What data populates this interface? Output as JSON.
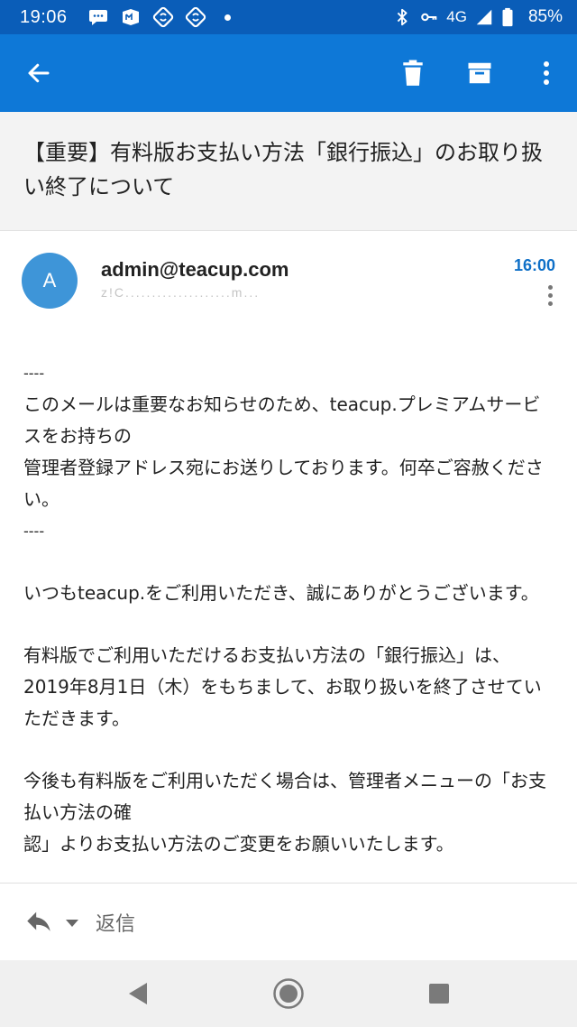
{
  "status_bar": {
    "time": "19:06",
    "network": "4G",
    "battery": "85%",
    "icons": [
      "chat-bubble-icon",
      "mail-app-icon",
      "sync-icon",
      "sync-icon",
      "bluetooth-icon",
      "key-icon",
      "signal-icon",
      "battery-icon"
    ]
  },
  "app_bar": {
    "back_icon": "arrow-left-icon",
    "actions": [
      "trash-icon",
      "archive-icon",
      "more-vertical-icon"
    ]
  },
  "subject": "【重要】有料版お支払い方法「銀行振込」のお取り扱い終了について",
  "message": {
    "avatar_letter": "A",
    "sender": "admin@teacup.com",
    "recipient_preview": "z!C....................m...",
    "time": "16:00"
  },
  "body": {
    "dash1": "----",
    "intro_line1": "このメールは重要なお知らせのため、teacup.プレミアムサービスをお持ちの",
    "intro_line2": "管理者登録アドレス宛にお送りしております。何卒ご容赦ください。",
    "dash2": "----",
    "greeting": "いつもteacup.をご利用いただき、誠にありがとうございます。",
    "announce_line1": "有料版でご利用いただけるお支払い方法の「銀行振込」は、",
    "announce_line2": "2019年8月1日（木）をもちまして、お取り扱いを終了させていただきます。",
    "followup_line1": "今後も有料版をご利用いただく場合は、管理者メニューの「お支払い方法の確",
    "followup_line2": "認」よりお支払い方法のご変更をお願いいたします。"
  },
  "reply_bar": {
    "label": "返信"
  },
  "nav": {
    "buttons": [
      "back-triangle-icon",
      "home-circle-icon",
      "recents-square-icon"
    ]
  },
  "colors": {
    "status_bar": "#0a5db8",
    "app_bar": "#0e78d7",
    "avatar": "#3e95d8",
    "time_accent": "#0e6fc7"
  }
}
